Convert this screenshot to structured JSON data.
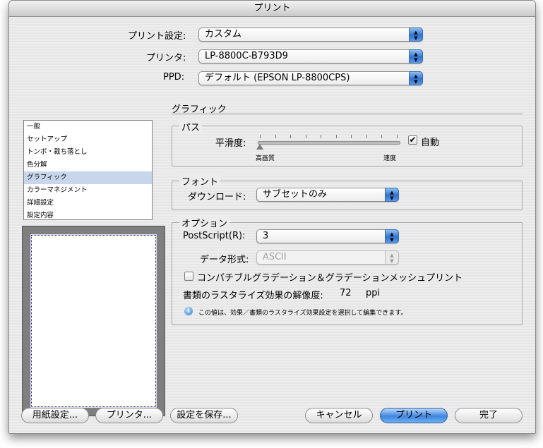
{
  "window": {
    "title": "プリント"
  },
  "top": {
    "preset_label": "プリント設定:",
    "preset_value": "カスタム",
    "printer_label": "プリンタ:",
    "printer_value": "LP-8800C-B793D9",
    "ppd_label": "PPD:",
    "ppd_value": "デフォルト (EPSON LP-8800CPS)"
  },
  "categories": {
    "items": [
      "一般",
      "セットアップ",
      "トンボ・裁ち落とし",
      "色分解",
      "グラフィック",
      "カラーマネジメント",
      "詳細設定",
      "設定内容"
    ],
    "selected": "グラフィック"
  },
  "section": {
    "title": "グラフィック"
  },
  "path": {
    "group_title": "パス",
    "smoothness_label": "平滑度:",
    "slider_value_percent": 0,
    "left_label": "高画質",
    "right_label": "速度",
    "auto_label": "自動",
    "auto_checked": true
  },
  "font": {
    "group_title": "フォント",
    "download_label": "ダウンロード:",
    "download_value": "サブセットのみ"
  },
  "options": {
    "group_title": "オプション",
    "postscript_label": "PostScript(R):",
    "postscript_value": "3",
    "format_label": "データ形式:",
    "format_value": "ASCII",
    "compatible_label": "コンパチブルグラデーション＆グラデーションメッシュプリント",
    "compatible_checked": false,
    "resolution_label": "書類のラスタライズ効果の解像度:",
    "resolution_value": "72",
    "resolution_unit": "ppi",
    "info_text": "この値は、効果／書類のラスタライズ効果設定を選択して編集できます。"
  },
  "buttons": {
    "paper_setup": "用紙設定...",
    "printer": "プリンタ...",
    "save_settings": "設定を保存...",
    "cancel": "キャンセル",
    "print": "プリント",
    "done": "完了"
  },
  "colors": {
    "accent": "#3f86de",
    "selection": "#c8d6ec",
    "window_bg": "#ececec"
  }
}
